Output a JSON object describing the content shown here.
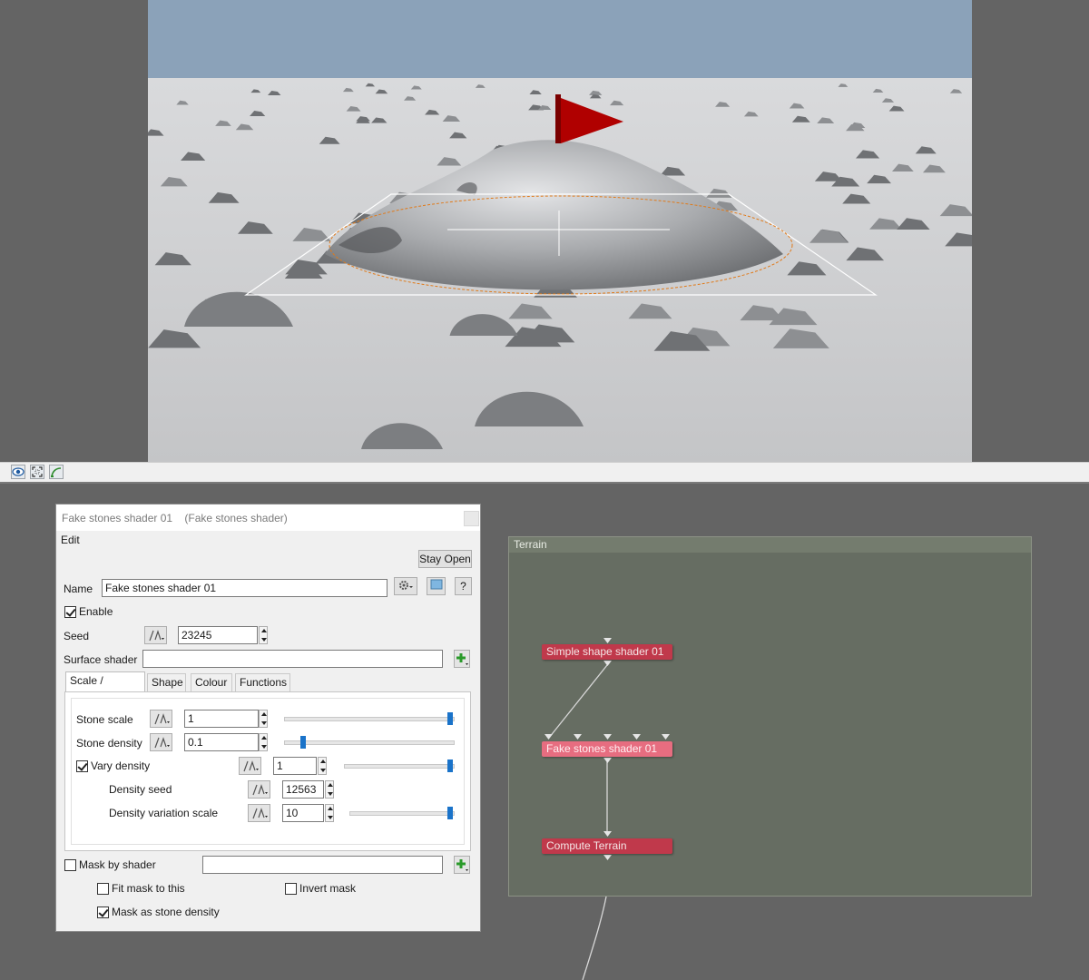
{
  "viewport": {
    "sky_color": "#8ba2b9",
    "ground_color": "#c8c9cb",
    "flag_color": "#b00000"
  },
  "toolbar": {
    "icons": [
      "eye-icon",
      "frame-icon",
      "curve-icon"
    ]
  },
  "dialog": {
    "title": "Fake stones shader 01    (Fake stones shader)",
    "menu_edit": "Edit",
    "stay_open": "Stay Open",
    "name_label": "Name",
    "name_value": "Fake stones shader 01",
    "help_label": "?",
    "enable_label": "Enable",
    "enable_checked": true,
    "seed_label": "Seed",
    "seed_value": "23245",
    "surface_shader_label": "Surface shader",
    "surface_shader_value": "",
    "tabs": [
      {
        "label": "Scale / Density",
        "active": true
      },
      {
        "label": "Shape",
        "active": false
      },
      {
        "label": "Colour",
        "active": false
      },
      {
        "label": "Functions",
        "active": false
      }
    ],
    "stone_scale_label": "Stone scale",
    "stone_scale_value": "1",
    "stone_scale_slider": 1.0,
    "stone_density_label": "Stone density",
    "stone_density_value": "0.1",
    "stone_density_slider": 0.1,
    "vary_density_label": "Vary density",
    "vary_density_checked": true,
    "vary_density_value": "1",
    "vary_density_slider": 1.0,
    "density_seed_label": "Density seed",
    "density_seed_value": "12563",
    "density_variation_scale_label": "Density variation scale",
    "density_variation_scale_value": "10",
    "density_variation_scale_slider": 1.0,
    "mask_by_shader_label": "Mask by shader",
    "mask_by_shader_checked": false,
    "fit_mask_label": "Fit mask to this",
    "fit_mask_checked": false,
    "invert_mask_label": "Invert mask",
    "invert_mask_checked": false,
    "mask_as_density_label": "Mask as stone density",
    "mask_as_density_checked": true
  },
  "node_panel": {
    "title": "Terrain",
    "nodes": [
      {
        "label": "Simple shape shader 01",
        "selected": false
      },
      {
        "label": "Fake stones shader 01",
        "selected": true
      },
      {
        "label": "Compute Terrain",
        "selected": false
      }
    ]
  }
}
